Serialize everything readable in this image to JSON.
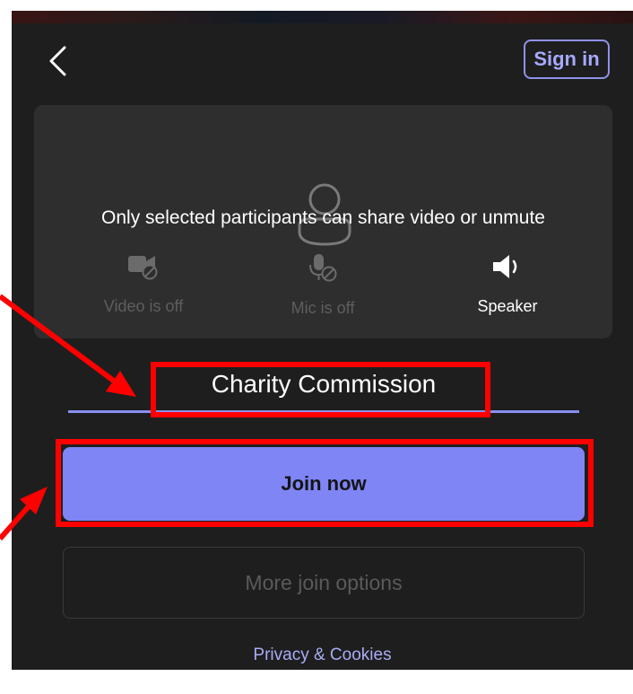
{
  "header": {
    "back_icon": "chevron-left-icon",
    "signin_label": "Sign in"
  },
  "preview": {
    "notice": "Only selected participants can share video or unmute",
    "avatar_icon": "person-icon",
    "controls": [
      {
        "icon": "video-off-icon",
        "label": "Video is off",
        "state": "disabled"
      },
      {
        "icon": "mic-off-icon",
        "label": "Mic is off",
        "state": "disabled"
      },
      {
        "icon": "speaker-icon",
        "label": "Speaker",
        "state": "enabled"
      }
    ]
  },
  "form": {
    "name_value": "Charity Commission"
  },
  "actions": {
    "join_label": "Join now",
    "more_options_label": "More join options"
  },
  "footer": {
    "privacy_label": "Privacy & Cookies"
  },
  "colors": {
    "accent": "#7f85f5",
    "background": "#1e1e1e",
    "annotation": "#ff0000"
  }
}
